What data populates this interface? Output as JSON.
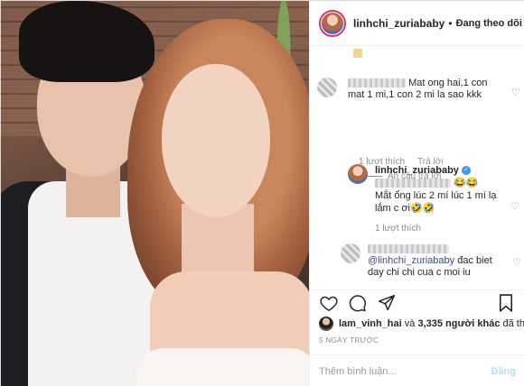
{
  "post": {
    "username": "linhchi_zuriababy",
    "separator": "•",
    "follow_label": "Đang theo dõi"
  },
  "comments": [
    {
      "text": "Mat ong hai,1 con mat 1 mi,1 con 2 mi la sao kkk",
      "likes": "1 lượt thích",
      "reply_label": "Trả lời",
      "hide_replies": "Ẩn câu trả lời"
    },
    {
      "username": "linhchi_zuriababy",
      "emoji": "😂😂",
      "text": "Mắt ổng lúc 2 mí lúc 1 mí lạ lắm c ơi🤣🤣",
      "likes": "1 lượt thích"
    },
    {
      "mention": "@linhchi_zuriababy",
      "text": "đac biet day chi chi cua c moi iu"
    }
  ],
  "likes_line": {
    "user": "lam_vinh_hai",
    "conjunction": "và",
    "others": "3,335 người khác",
    "suffix": "đã thích"
  },
  "time_ago": "5 NGÀY TRƯỚC",
  "add_comment": {
    "placeholder": "Thêm bình luận...",
    "post_label": "Đăng"
  },
  "icons": {
    "like": "heart-icon",
    "comment": "comment-icon",
    "share": "share-icon",
    "save": "bookmark-icon"
  },
  "colors": {
    "follow_ring": "#e1306c",
    "verified": "#3897f0",
    "mention": "#3b4b8c",
    "post_disabled": "#b2dffc"
  }
}
